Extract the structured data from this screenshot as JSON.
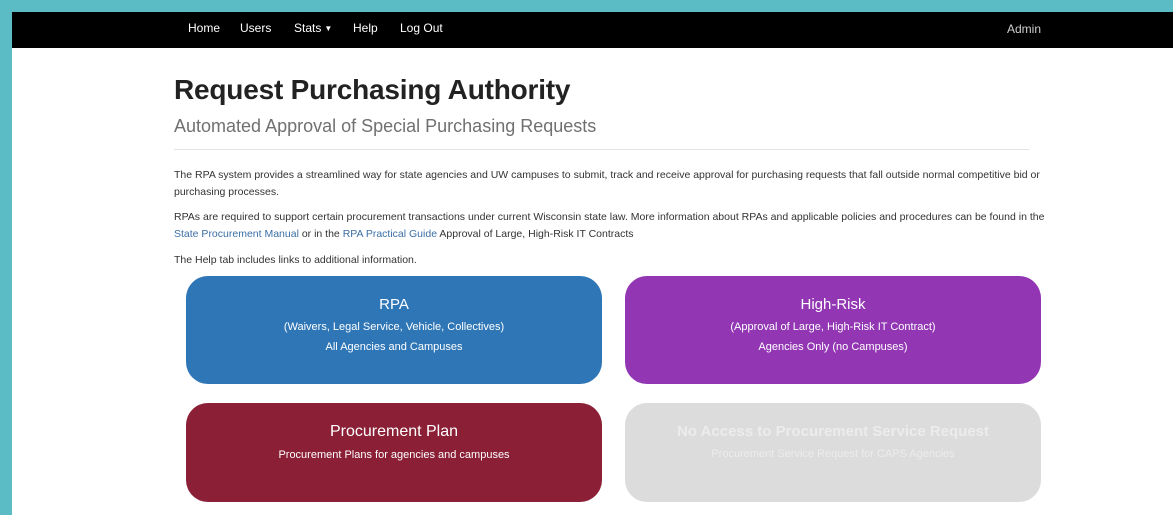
{
  "nav": {
    "items": [
      "Home",
      "Users",
      "Stats",
      "Help",
      "Log Out"
    ],
    "user": "Admin"
  },
  "header": {
    "title": "Request Purchasing Authority",
    "subtitle": "Automated Approval of Special Purchasing Requests"
  },
  "intro": {
    "p1": "The RPA system provides a streamlined way for state agencies and UW campuses to submit, track and receive approval for purchasing requests that fall outside normal competitive bid or purchasing processes.",
    "p2_a": "RPAs are required to support certain procurement transactions under current Wisconsin state law. More information about RPAs and applicable policies and procedures can be found in the ",
    "p2_link1": "State Procurement Manual",
    "p2_b": " or in the ",
    "p2_link2": "RPA Practical Guide",
    "p2_c": " Approval of Large, High-Risk IT Contracts",
    "p3": "The Help tab includes links to additional information."
  },
  "cards": {
    "rpa": {
      "title": "RPA",
      "line1": "(Waivers, Legal Service, Vehicle, Collectives)",
      "line2": "All Agencies and Campuses",
      "color": "#2f76b7"
    },
    "high_risk": {
      "title": "High-Risk",
      "line1": "(Approval of Large, High-Risk IT Contract)",
      "line2": "Agencies Only (no Campuses)",
      "color": "#9236b4"
    },
    "plan": {
      "title": "Procurement Plan",
      "line1": "Procurement Plans for agencies and campuses",
      "color": "#8a1f36"
    },
    "psr": {
      "title": "No Access to Procurement Service Request",
      "line1": "Procurement Service Request for CAPS Agencies",
      "color": "#dcdcdc"
    }
  }
}
